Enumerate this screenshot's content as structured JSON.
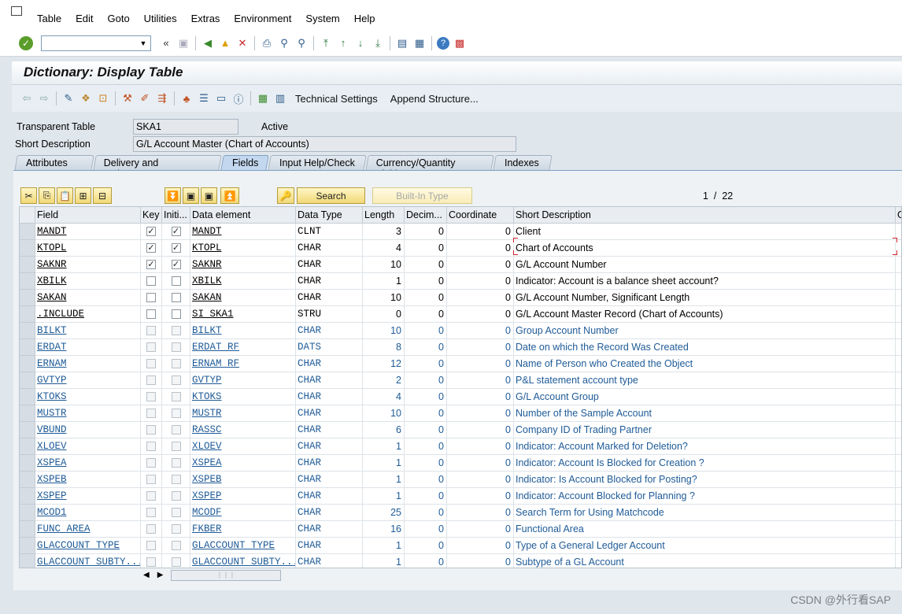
{
  "menu": [
    "Table",
    "Edit",
    "Goto",
    "Utilities",
    "Extras",
    "Environment",
    "System",
    "Help"
  ],
  "title": "Dictionary: Display Table",
  "apptoolbar": {
    "tech_settings": "Technical Settings",
    "append": "Append Structure..."
  },
  "header": {
    "table_type_label": "Transparent Table",
    "table_name": "SKA1",
    "status": "Active",
    "short_desc_label": "Short Description",
    "short_desc": "G/L Account Master (Chart of Accounts)"
  },
  "tabs": [
    "Attributes",
    "Delivery and Maintenance",
    "Fields",
    "Input Help/Check",
    "Currency/Quantity Fields",
    "Indexes"
  ],
  "active_tab": "Fields",
  "table_toolbar": {
    "search": "Search",
    "builtin": "Built-In Type"
  },
  "pager": {
    "current": "1",
    "sep": "/",
    "total": "22"
  },
  "grid": {
    "columns": [
      "Field",
      "Key",
      "Initi...",
      "Data element",
      "Data Type",
      "Length",
      "Decim...",
      "Coordinate",
      "Short Description",
      "G"
    ],
    "rows": [
      {
        "field": "MANDT",
        "key": true,
        "init": true,
        "de": "MANDT",
        "type": "CLNT",
        "len": "3",
        "dec": "0",
        "coord": "0",
        "desc": "Client",
        "blue": false
      },
      {
        "field": "KTOPL",
        "key": true,
        "init": true,
        "de": "KTOPL",
        "type": "CHAR",
        "len": "4",
        "dec": "0",
        "coord": "0",
        "desc": "Chart of Accounts",
        "blue": false
      },
      {
        "field": "SAKNR",
        "key": true,
        "init": true,
        "de": "SAKNR",
        "type": "CHAR",
        "len": "10",
        "dec": "0",
        "coord": "0",
        "desc": "G/L Account Number",
        "blue": false
      },
      {
        "field": "XBILK",
        "key": false,
        "init": false,
        "de": "XBILK",
        "type": "CHAR",
        "len": "1",
        "dec": "0",
        "coord": "0",
        "desc": "Indicator: Account is a balance sheet account?",
        "blue": false
      },
      {
        "field": "SAKAN",
        "key": false,
        "init": false,
        "de": "SAKAN",
        "type": "CHAR",
        "len": "10",
        "dec": "0",
        "coord": "0",
        "desc": "G/L Account Number, Significant Length",
        "blue": false
      },
      {
        "field": ".INCLUDE",
        "key": false,
        "init": false,
        "de": "SI_SKA1",
        "type": "STRU",
        "len": "0",
        "dec": "0",
        "coord": "0",
        "desc": "G/L Account Master Record (Chart of Accounts)",
        "blue": false
      },
      {
        "field": "BILKT",
        "key": false,
        "init": false,
        "de": "BILKT",
        "type": "CHAR",
        "len": "10",
        "dec": "0",
        "coord": "0",
        "desc": "Group Account Number",
        "blue": true
      },
      {
        "field": "ERDAT",
        "key": false,
        "init": false,
        "de": "ERDAT_RF",
        "type": "DATS",
        "len": "8",
        "dec": "0",
        "coord": "0",
        "desc": "Date on which the Record Was Created",
        "blue": true
      },
      {
        "field": "ERNAM",
        "key": false,
        "init": false,
        "de": "ERNAM_RF",
        "type": "CHAR",
        "len": "12",
        "dec": "0",
        "coord": "0",
        "desc": "Name of Person who Created the Object",
        "blue": true
      },
      {
        "field": "GVTYP",
        "key": false,
        "init": false,
        "de": "GVTYP",
        "type": "CHAR",
        "len": "2",
        "dec": "0",
        "coord": "0",
        "desc": "P&L statement account type",
        "blue": true
      },
      {
        "field": "KTOKS",
        "key": false,
        "init": false,
        "de": "KTOKS",
        "type": "CHAR",
        "len": "4",
        "dec": "0",
        "coord": "0",
        "desc": "G/L Account Group",
        "blue": true
      },
      {
        "field": "MUSTR",
        "key": false,
        "init": false,
        "de": "MUSTR",
        "type": "CHAR",
        "len": "10",
        "dec": "0",
        "coord": "0",
        "desc": "Number of the Sample Account",
        "blue": true
      },
      {
        "field": "VBUND",
        "key": false,
        "init": false,
        "de": "RASSC",
        "type": "CHAR",
        "len": "6",
        "dec": "0",
        "coord": "0",
        "desc": "Company ID of Trading Partner",
        "blue": true
      },
      {
        "field": "XLOEV",
        "key": false,
        "init": false,
        "de": "XLOEV",
        "type": "CHAR",
        "len": "1",
        "dec": "0",
        "coord": "0",
        "desc": "Indicator: Account Marked for Deletion?",
        "blue": true
      },
      {
        "field": "XSPEA",
        "key": false,
        "init": false,
        "de": "XSPEA",
        "type": "CHAR",
        "len": "1",
        "dec": "0",
        "coord": "0",
        "desc": "Indicator: Account Is Blocked for Creation ?",
        "blue": true
      },
      {
        "field": "XSPEB",
        "key": false,
        "init": false,
        "de": "XSPEB",
        "type": "CHAR",
        "len": "1",
        "dec": "0",
        "coord": "0",
        "desc": "Indicator: Is Account Blocked for Posting?",
        "blue": true
      },
      {
        "field": "XSPEP",
        "key": false,
        "init": false,
        "de": "XSPEP",
        "type": "CHAR",
        "len": "1",
        "dec": "0",
        "coord": "0",
        "desc": "Indicator: Account Blocked for Planning ?",
        "blue": true
      },
      {
        "field": "MCOD1",
        "key": false,
        "init": false,
        "de": "MCODF",
        "type": "CHAR",
        "len": "25",
        "dec": "0",
        "coord": "0",
        "desc": "Search Term for Using Matchcode",
        "blue": true
      },
      {
        "field": "FUNC_AREA",
        "key": false,
        "init": false,
        "de": "FKBER",
        "type": "CHAR",
        "len": "16",
        "dec": "0",
        "coord": "0",
        "desc": "Functional Area",
        "blue": true
      },
      {
        "field": "GLACCOUNT_TYPE",
        "key": false,
        "init": false,
        "de": "GLACCOUNT_TYPE",
        "type": "CHAR",
        "len": "1",
        "dec": "0",
        "coord": "0",
        "desc": "Type of a General Ledger Account",
        "blue": true
      },
      {
        "field": "GLACCOUNT_SUBTY...",
        "key": false,
        "init": false,
        "de": "GLACCOUNT_SUBTY...",
        "type": "CHAR",
        "len": "1",
        "dec": "0",
        "coord": "0",
        "desc": "Subtype of a GL Account",
        "blue": true
      }
    ]
  },
  "watermark": "CSDN @外行看SAP",
  "colors": {
    "link_blue": "#1f5b97",
    "button_yellow": "#f1d978",
    "tab_active": "#c3d8ef"
  }
}
